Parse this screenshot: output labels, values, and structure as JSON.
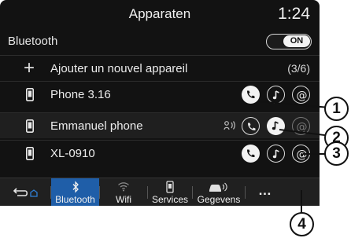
{
  "header": {
    "title": "Apparaten",
    "time": "1:24"
  },
  "bluetooth": {
    "label": "Bluetooth",
    "toggle": "ON"
  },
  "add_device": {
    "label": "Ajouter un nouvel appareil",
    "count": "(3/6)"
  },
  "devices": [
    {
      "name": "Phone 3.16"
    },
    {
      "name": "Emmanuel phone"
    },
    {
      "name": "XL-0910"
    }
  ],
  "tabs": [
    {
      "label": ""
    },
    {
      "label": "Bluetooth"
    },
    {
      "label": "Wifi"
    },
    {
      "label": "Services"
    },
    {
      "label": "Gegevens"
    },
    {
      "label": "…"
    }
  ],
  "callouts": [
    "1",
    "2",
    "3",
    "4"
  ],
  "colors": {
    "background": "#121212",
    "active_tab": "#1f5ea8",
    "text": "#ececec"
  }
}
